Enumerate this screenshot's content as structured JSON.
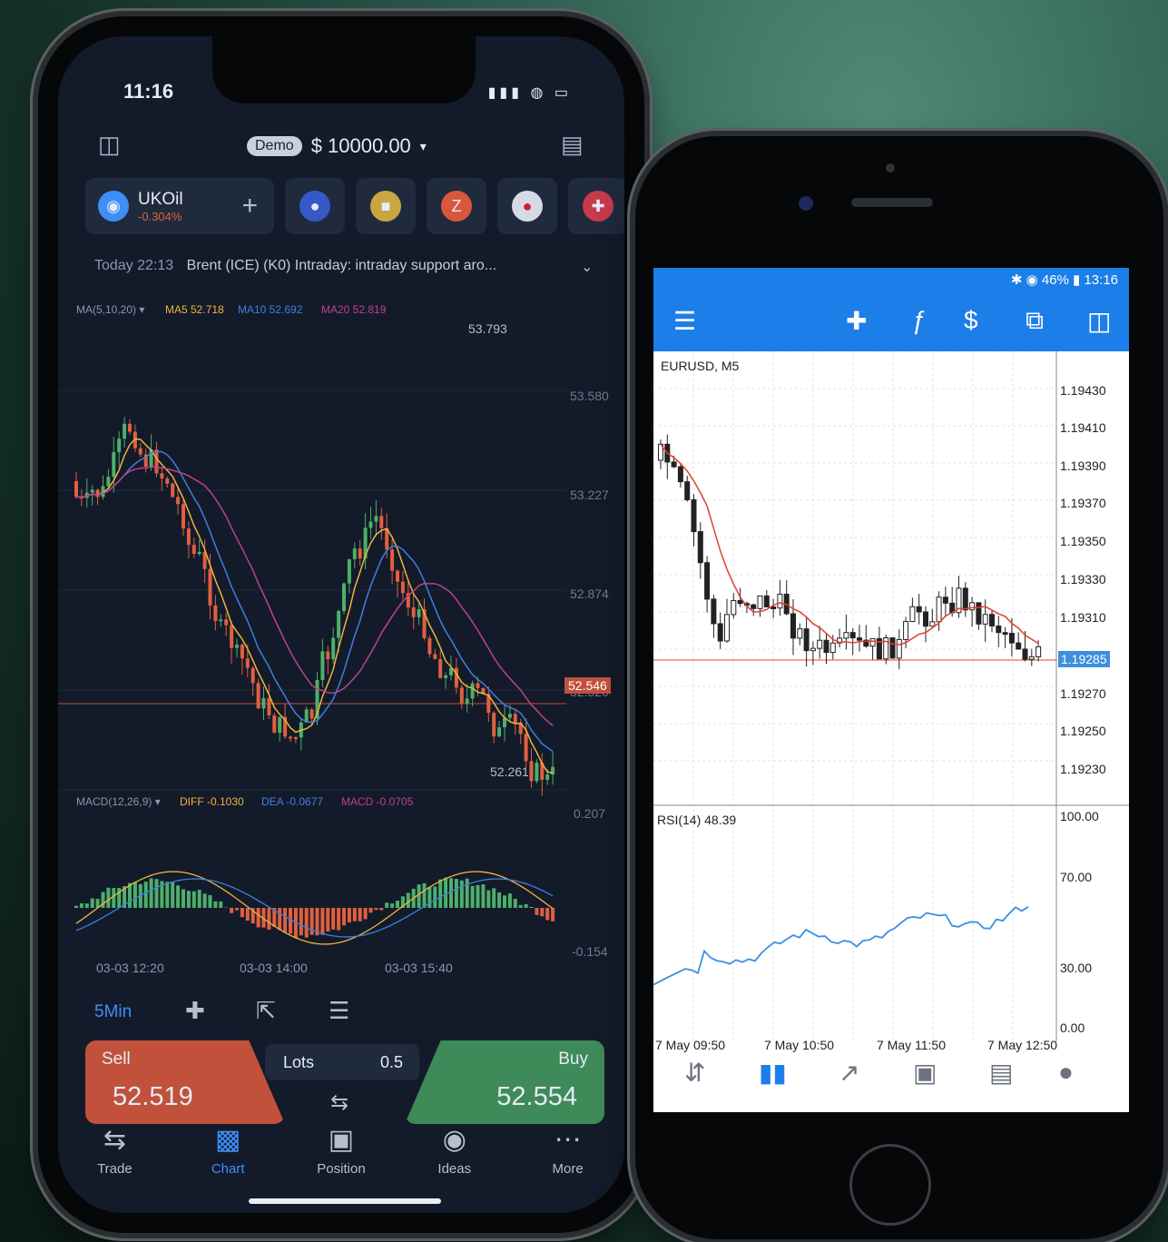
{
  "left_app": {
    "status": {
      "time": "11:16"
    },
    "header": {
      "demo_badge": "Demo",
      "balance": "$ 10000.00"
    },
    "symbol": {
      "name": "UKOil",
      "change": "-0.304%"
    },
    "news": {
      "time": "Today 22:13",
      "text": "Brent (ICE) (K0) Intraday: intraday support aro..."
    },
    "ma_indicator": {
      "label": "MA(5,10,20) ▾",
      "ma5": "MA5 52.718",
      "ma10": "MA10 52.692",
      "ma20": "MA20 52.819"
    },
    "price_axis": [
      "53.580",
      "53.227",
      "52.874",
      "52.520"
    ],
    "high_label": "53.793",
    "low_label": "52.261",
    "current_price": "52.546",
    "macd_indicator": {
      "label": "MACD(12,26,9) ▾",
      "diff": "DIFF -0.1030",
      "dea": "DEA -0.0677",
      "macd": "MACD -0.0705"
    },
    "macd_axis": [
      "0.207",
      "-0.154"
    ],
    "time_axis": [
      "03-03 12:20",
      "03-03 14:00",
      "03-03 15:40"
    ],
    "timeframe": "5Min",
    "trade": {
      "sell_label": "Sell",
      "sell_price": "52.519",
      "lots_label": "Lots",
      "lots_value": "0.5",
      "buy_label": "Buy",
      "buy_price": "52.554"
    },
    "nav": [
      "Trade",
      "Chart",
      "Position",
      "Ideas",
      "More"
    ],
    "colors": {
      "up": "#4caf6a",
      "down": "#e0603f",
      "ma5": "#f0b43c",
      "ma10": "#3d7fe0",
      "ma20": "#c0408a",
      "accent": "#3f8ef7"
    }
  },
  "right_app": {
    "status": "✱ ◉ 46% ▮ 13:16",
    "symbol_label": "EURUSD, M5",
    "price_axis": [
      "1.19430",
      "1.19410",
      "1.19390",
      "1.19370",
      "1.19350",
      "1.19330",
      "1.19310",
      "1.19270",
      "1.19250",
      "1.19230"
    ],
    "current_price": "1.19285",
    "rsi_label": "RSI(14) 48.39",
    "rsi_axis": [
      "100.00",
      "70.00",
      "30.00",
      "0.00"
    ],
    "time_axis": [
      "7 May 09:50",
      "7 May 10:50",
      "7 May 11:50",
      "7 May 12:50"
    ],
    "colors": {
      "toolbar": "#1c7ee8",
      "ma": "#e0402c",
      "rsi": "#3d8fe0"
    }
  }
}
